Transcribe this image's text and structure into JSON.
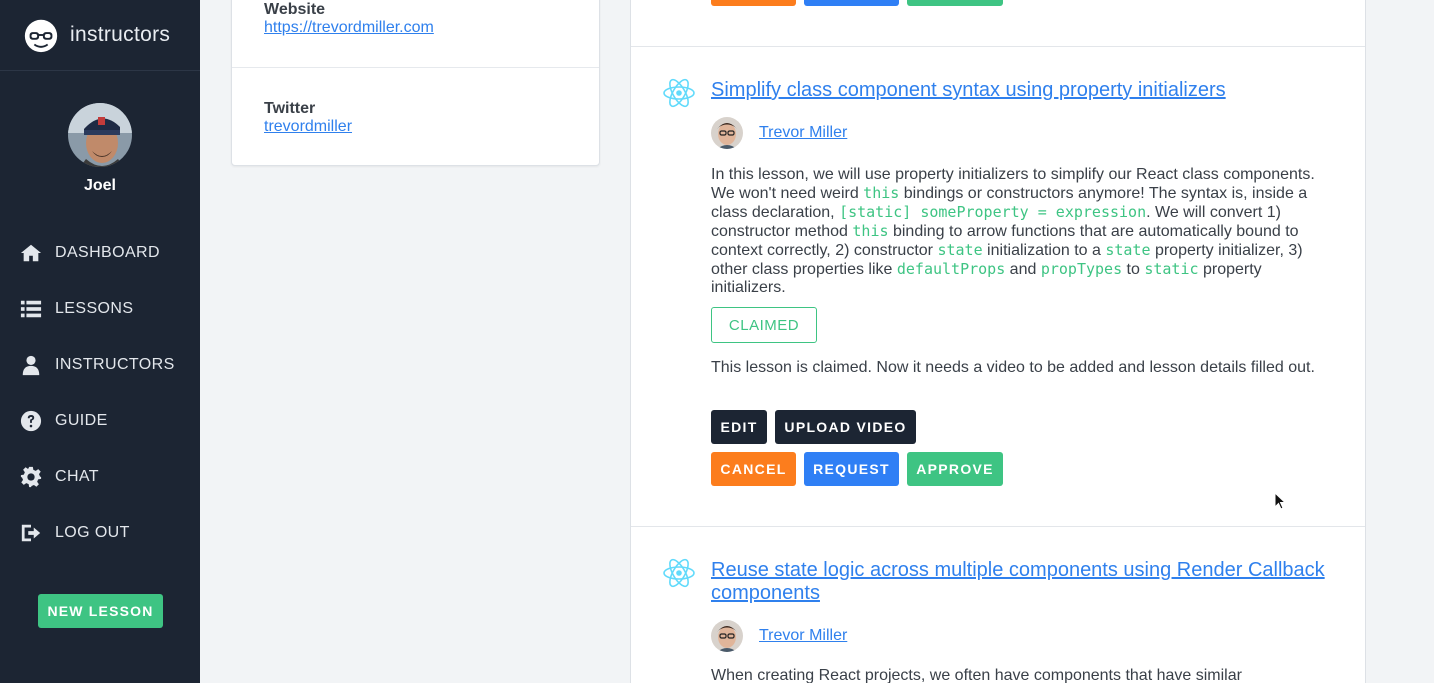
{
  "brand": {
    "title": "instructors"
  },
  "profile": {
    "name": "Joel"
  },
  "sidebar": {
    "items": [
      {
        "label": "DASHBOARD",
        "icon": "home-icon"
      },
      {
        "label": "LESSONS",
        "icon": "list-icon"
      },
      {
        "label": "INSTRUCTORS",
        "icon": "user-icon"
      },
      {
        "label": "GUIDE",
        "icon": "question-icon"
      },
      {
        "label": "CHAT",
        "icon": "gear-icon"
      },
      {
        "label": "LOG OUT",
        "icon": "sign-out-icon"
      }
    ],
    "new_lesson_label": "NEW LESSON"
  },
  "info_card": {
    "website_label": "Website",
    "website_value": "https://trevordmiller.com",
    "twitter_label": "Twitter",
    "twitter_value": "trevordmiller"
  },
  "lesson1": {
    "title": "Simplify class component syntax using property initializers",
    "author": "Trevor Miller",
    "desc": {
      "t1": "In this lesson, we will use property initializers to simplify our React class components. We won't need weird ",
      "c1": "this",
      "t2": " bindings or constructors anymore! The syntax is, inside a class declaration, ",
      "c2": "[static] someProperty = expression",
      "t3": ". We will convert 1) constructor method ",
      "c3": "this",
      "t4": " binding to arrow functions that are automatically bound to context correctly, 2) constructor ",
      "c4": "state",
      "t5": " initialization to a ",
      "c5": "state",
      "t6": " property initializer, 3) other class properties like ",
      "c6": "defaultProps",
      "t7": " and ",
      "c7": "propTypes",
      "t8": " to ",
      "c8": "static",
      "t9": " property initializers."
    },
    "badge": "CLAIMED",
    "status": "This lesson is claimed. Now it needs a video to be added and lesson details filled out.",
    "buttons": {
      "edit": "EDIT",
      "upload": "UPLOAD VIDEO",
      "cancel": "CANCEL",
      "request": "REQUEST",
      "approve": "APPROVE"
    }
  },
  "lesson2": {
    "title": "Reuse state logic across multiple components using Render Callback components",
    "author": "Trevor Miller",
    "desc": "When creating React projects, we often have components that have similar"
  },
  "colors": {
    "sidebar": "#1c2533",
    "link": "#2f80ed",
    "green": "#3ec483",
    "orange": "#fc7d1d",
    "blue": "#2f7ff5"
  }
}
